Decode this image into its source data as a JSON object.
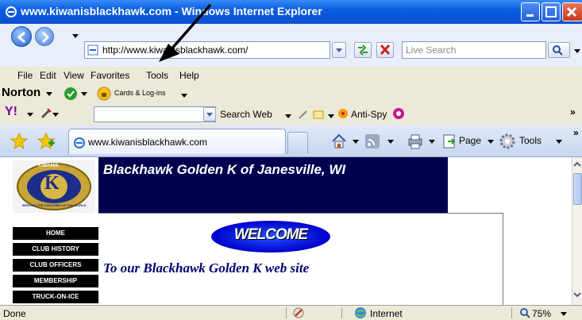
{
  "window": {
    "title": "www.kiwanisblackhawk.com - Windows Internet Explorer"
  },
  "address_bar": {
    "url": "http://www.kiwanisblackhawk.com/"
  },
  "search": {
    "placeholder": "Live Search"
  },
  "menu": {
    "items": [
      "File",
      "Edit",
      "View",
      "Favorites",
      "Tools",
      "Help"
    ]
  },
  "norton_toolbar": {
    "brand": "Norton",
    "cards_label": "Cards & Log-ins"
  },
  "yahoo_toolbar": {
    "logo": "Y!",
    "search_web_label": "Search Web",
    "antispy_label": "Anti-Spy"
  },
  "tab": {
    "label": "www.kiwanisblackhawk.com"
  },
  "command_bar": {
    "page_label": "Page",
    "tools_label": "Tools"
  },
  "page": {
    "title": "Blackhawk Golden K of Janesville, WI",
    "welcome": "WELCOME",
    "subheading": "To our Blackhawk Golden K web site",
    "nav": [
      "HOME",
      "CLUB HISTORY",
      "CLUB OFFICERS",
      "MEMBERSHIP",
      "TRUCK-ON-ICE"
    ],
    "logo_letter": "K",
    "logo_ring_top": "KIWANIS",
    "logo_ring_bottom": "SERVING THE CHILDREN OF THE WORLD"
  },
  "status_bar": {
    "status": "Done",
    "zone": "Internet",
    "zoom": "75%"
  },
  "colors": {
    "titlebar": "#0a5ee0",
    "header_band": "#00004e",
    "nav_bg": "#000000",
    "subheading": "#00006f"
  }
}
